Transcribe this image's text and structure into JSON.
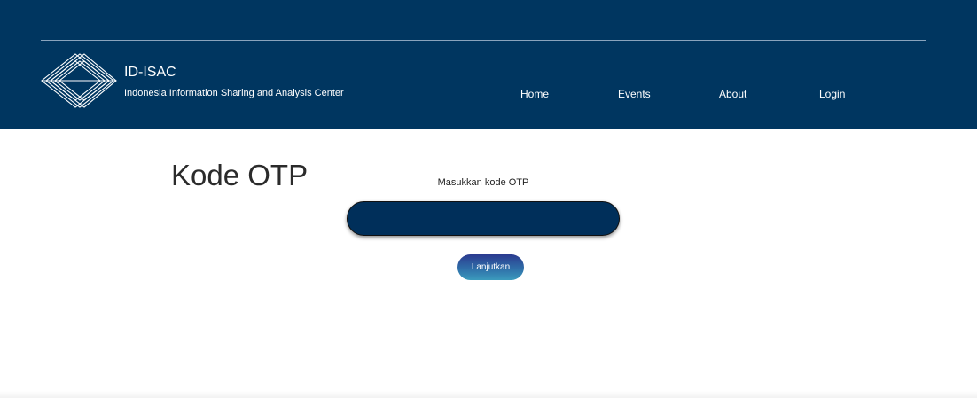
{
  "header": {
    "brand_title": "ID-ISAC",
    "brand_subtitle": "Indonesia Information Sharing and Analysis Center",
    "logo_icon": "stacked-diamond-logo-icon",
    "background_color": "#003660"
  },
  "nav": {
    "items": [
      {
        "label": "Home"
      },
      {
        "label": "Events"
      },
      {
        "label": "About"
      },
      {
        "label": "Login"
      }
    ]
  },
  "main": {
    "title": "Kode OTP",
    "field_label": "Masukkan kode OTP",
    "otp_input": {
      "value": "",
      "placeholder": ""
    },
    "continue_button_label": "Lanjutkan"
  },
  "colors": {
    "header": "#003660",
    "input": "#002f5a",
    "button_gradient_top": "#2b3a8f",
    "button_gradient_bottom": "#3b9bbd"
  }
}
